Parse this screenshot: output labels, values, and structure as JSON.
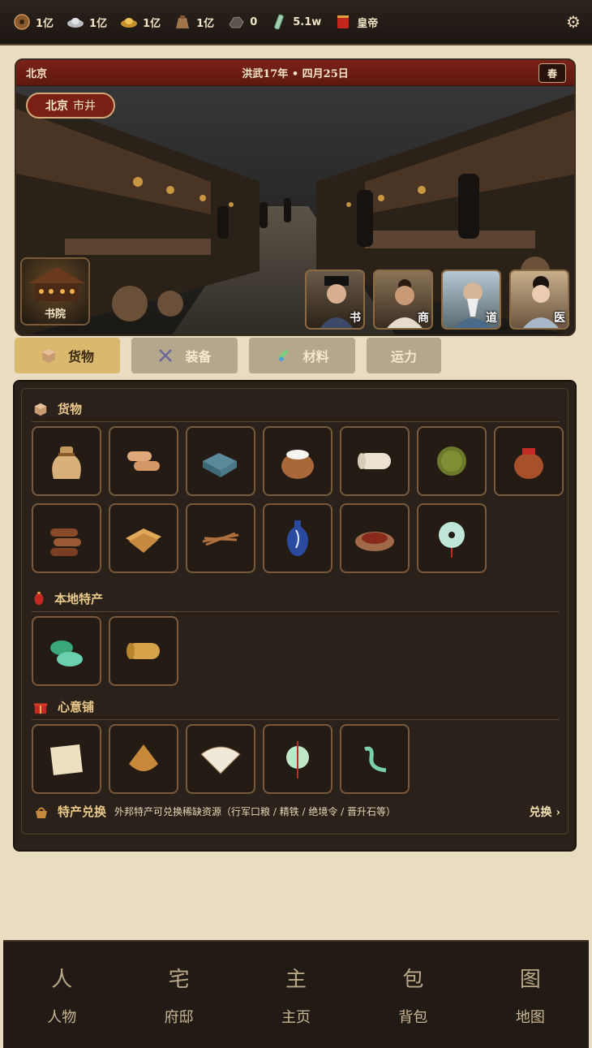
{
  "resources": [
    {
      "icon": "copper-coin-icon",
      "value": "1亿"
    },
    {
      "icon": "silver-ingot-icon",
      "value": "1亿"
    },
    {
      "icon": "gold-ingot-icon",
      "value": "1亿"
    },
    {
      "icon": "grain-sack-icon",
      "value": "1亿"
    },
    {
      "icon": "iron-ore-icon",
      "value": "0"
    },
    {
      "icon": "jade-token-icon",
      "value": "5.1w"
    },
    {
      "icon": "imperial-edict-icon",
      "value": "皇帝"
    }
  ],
  "scene": {
    "city": "北京",
    "date": "洪武17年 • 四月25日",
    "season": "春",
    "location_city": "北京",
    "location_name": "市井",
    "academy_label": "书院",
    "npcs": [
      {
        "role": "书",
        "icon": "scholar-portrait"
      },
      {
        "role": "商",
        "icon": "merchant-portrait"
      },
      {
        "role": "道",
        "icon": "taoist-portrait"
      },
      {
        "role": "医",
        "icon": "doctor-portrait"
      }
    ]
  },
  "tabs": [
    {
      "label": "货物",
      "icon": "box-icon",
      "active": true
    },
    {
      "label": "装备",
      "icon": "crossed-swords-icon",
      "active": false
    },
    {
      "label": "材料",
      "icon": "herb-icon",
      "active": false
    },
    {
      "label": "运力",
      "icon": "",
      "active": false
    }
  ],
  "sections": {
    "goods": {
      "title": "货物",
      "icon": "box-icon",
      "items": [
        "cloth-bag",
        "silk-rolls",
        "tea-bricks",
        "salt-jar",
        "cotton-bolt",
        "tea-cake",
        "wine-jar",
        "timber-logs",
        "paper-sheets",
        "herb-bundle",
        "porcelain-vase",
        "dried-meat",
        "jade-disc"
      ]
    },
    "local": {
      "title": "本地特产",
      "icon": "lantern-icon",
      "items": [
        "jade-stones",
        "brocade-roll"
      ]
    },
    "gift": {
      "title": "心意铺",
      "icon": "gift-icon",
      "items": [
        "handkerchief",
        "sachet",
        "folding-fan",
        "jade-pendant",
        "jade-hairpin"
      ]
    }
  },
  "exchange": {
    "title": "特产兑换",
    "desc": "外邦特产可兑换稀缺资源（行军口粮 / 精铁 / 绝境令 / 晋升石等）",
    "button": "兑换 ›"
  },
  "nav": [
    {
      "glyph": "人",
      "label": "人物"
    },
    {
      "glyph": "宅",
      "label": "府邸"
    },
    {
      "glyph": "主",
      "label": "主页"
    },
    {
      "glyph": "包",
      "label": "背包"
    },
    {
      "glyph": "图",
      "label": "地图"
    }
  ],
  "colors": {
    "accent": "#d9b96d",
    "header_red": "#7a2218",
    "panel": "#2a221a",
    "cream": "#e9dcc0"
  }
}
